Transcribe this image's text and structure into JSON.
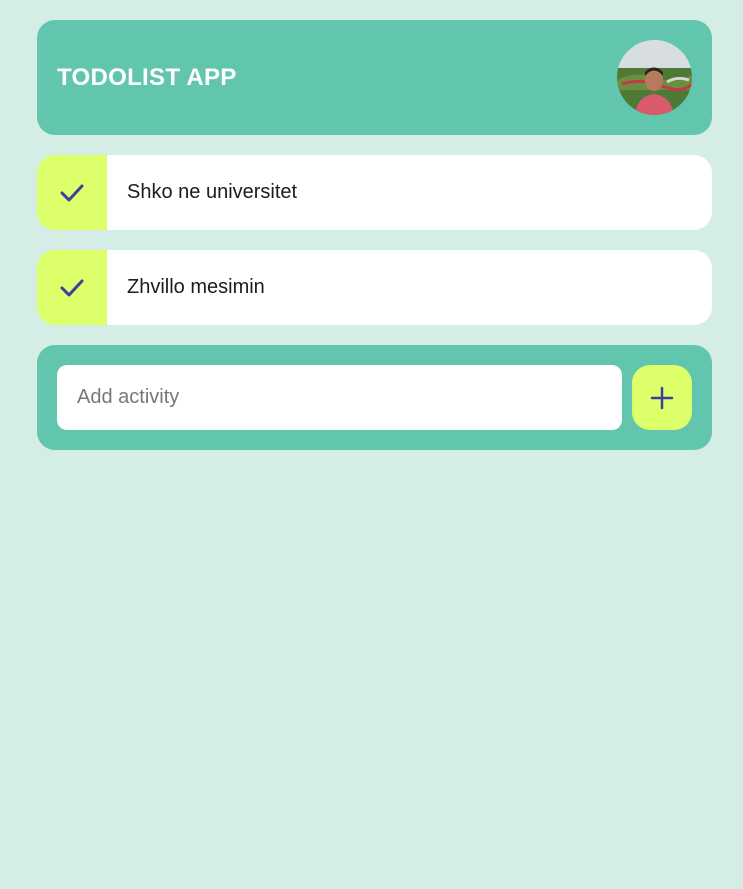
{
  "header": {
    "title": "TODOLIST APP"
  },
  "todos": [
    {
      "label": "Shko ne universitet",
      "done": true
    },
    {
      "label": "Zhvillo mesimin",
      "done": true
    }
  ],
  "add_form": {
    "placeholder": "Add activity",
    "value": ""
  },
  "icons": {
    "check": "check-icon",
    "add": "plus-icon",
    "avatar": "user-avatar"
  },
  "colors": {
    "background": "#d4eee5",
    "primary": "#62c6ae",
    "accent": "#dcff6a",
    "icon": "#3a3fa0",
    "card": "#ffffff"
  }
}
